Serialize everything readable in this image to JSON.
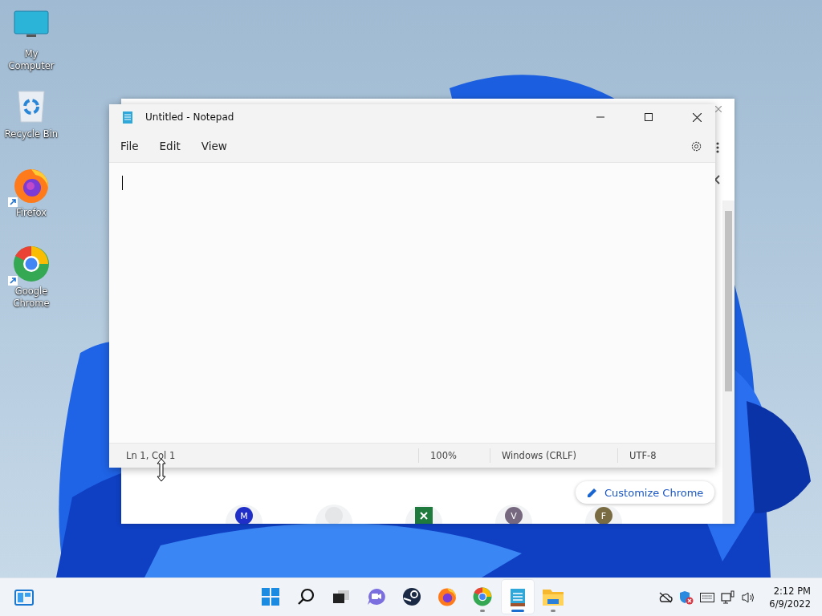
{
  "desktop_icons": [
    {
      "kind": "computer",
      "label": "My Computer",
      "shortcut": false
    },
    {
      "kind": "recycle",
      "label": "Recycle Bin",
      "shortcut": false
    },
    {
      "kind": "firefox",
      "label": "Firefox",
      "shortcut": true
    },
    {
      "kind": "chrome",
      "label": "Google Chrome",
      "shortcut": true
    }
  ],
  "browser_window": {
    "customize_button": "Customize Chrome",
    "shortcuts": [
      {
        "kind": "letter",
        "letter": "M",
        "color": "#1f2fc8"
      },
      {
        "kind": "blank"
      },
      {
        "kind": "sheet"
      },
      {
        "kind": "letter",
        "letter": "V",
        "color": "#76687e"
      },
      {
        "kind": "letter",
        "letter": "F",
        "color": "#7a6c42"
      }
    ]
  },
  "notepad": {
    "title": "Untitled - Notepad",
    "menu": [
      "File",
      "Edit",
      "View"
    ],
    "status_bar": [
      "Ln 1, Col 1",
      "100%",
      "Windows (CRLF)",
      "UTF-8"
    ]
  },
  "taskbar": {
    "apps": [
      {
        "kind": "start",
        "running": false,
        "selected": false
      },
      {
        "kind": "search",
        "running": false,
        "selected": false
      },
      {
        "kind": "taskview",
        "running": false,
        "selected": false
      },
      {
        "kind": "chat",
        "running": false,
        "selected": false
      },
      {
        "kind": "steam",
        "running": false,
        "selected": false
      },
      {
        "kind": "firefox",
        "running": false,
        "selected": false
      },
      {
        "kind": "chrome",
        "running": true,
        "selected": false
      },
      {
        "kind": "notepad",
        "running": true,
        "selected": true
      },
      {
        "kind": "explorer",
        "running": true,
        "selected": false
      }
    ],
    "time": "2:12 PM",
    "date": "6/9/2022"
  }
}
